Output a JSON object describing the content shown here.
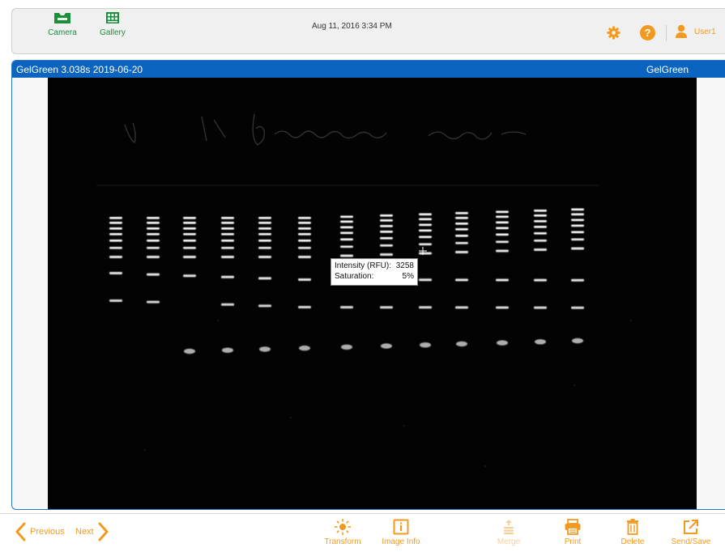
{
  "topbar": {
    "camera_label": "Camera",
    "gallery_label": "Gallery",
    "datetime": "Aug 11, 2016  3:34 PM",
    "user_label": "User1",
    "icons": {
      "camera": "camera-icon",
      "gallery": "gallery-icon",
      "settings": "gear-icon",
      "help": "help-icon",
      "user": "user-icon"
    },
    "help_glyph": "?"
  },
  "viewer": {
    "title": "GelGreen 3.038s 2019-06-20",
    "channel": "GelGreen",
    "tooltip": {
      "intensity_label": "Intensity (RFU):",
      "intensity_value": "3258",
      "saturation_label": "Saturation:",
      "saturation_value": "5%"
    }
  },
  "bottombar": {
    "previous_label": "Previous",
    "next_label": "Next",
    "tools": [
      {
        "label": "Transform",
        "icon": "sun-icon",
        "enabled": true
      },
      {
        "label": "Image Info",
        "icon": "info-icon",
        "enabled": true
      },
      {
        "label": "Merge",
        "icon": "merge-icon",
        "enabled": false
      },
      {
        "label": "Print",
        "icon": "printer-icon",
        "enabled": true
      },
      {
        "label": "Delete",
        "icon": "trash-icon",
        "enabled": true
      },
      {
        "label": "Send/Save",
        "icon": "export-icon",
        "enabled": true
      }
    ]
  },
  "colors": {
    "accent_orange": "#f29a1f",
    "nav_green": "#1a8f3c",
    "title_blue": "#0a64c0"
  }
}
